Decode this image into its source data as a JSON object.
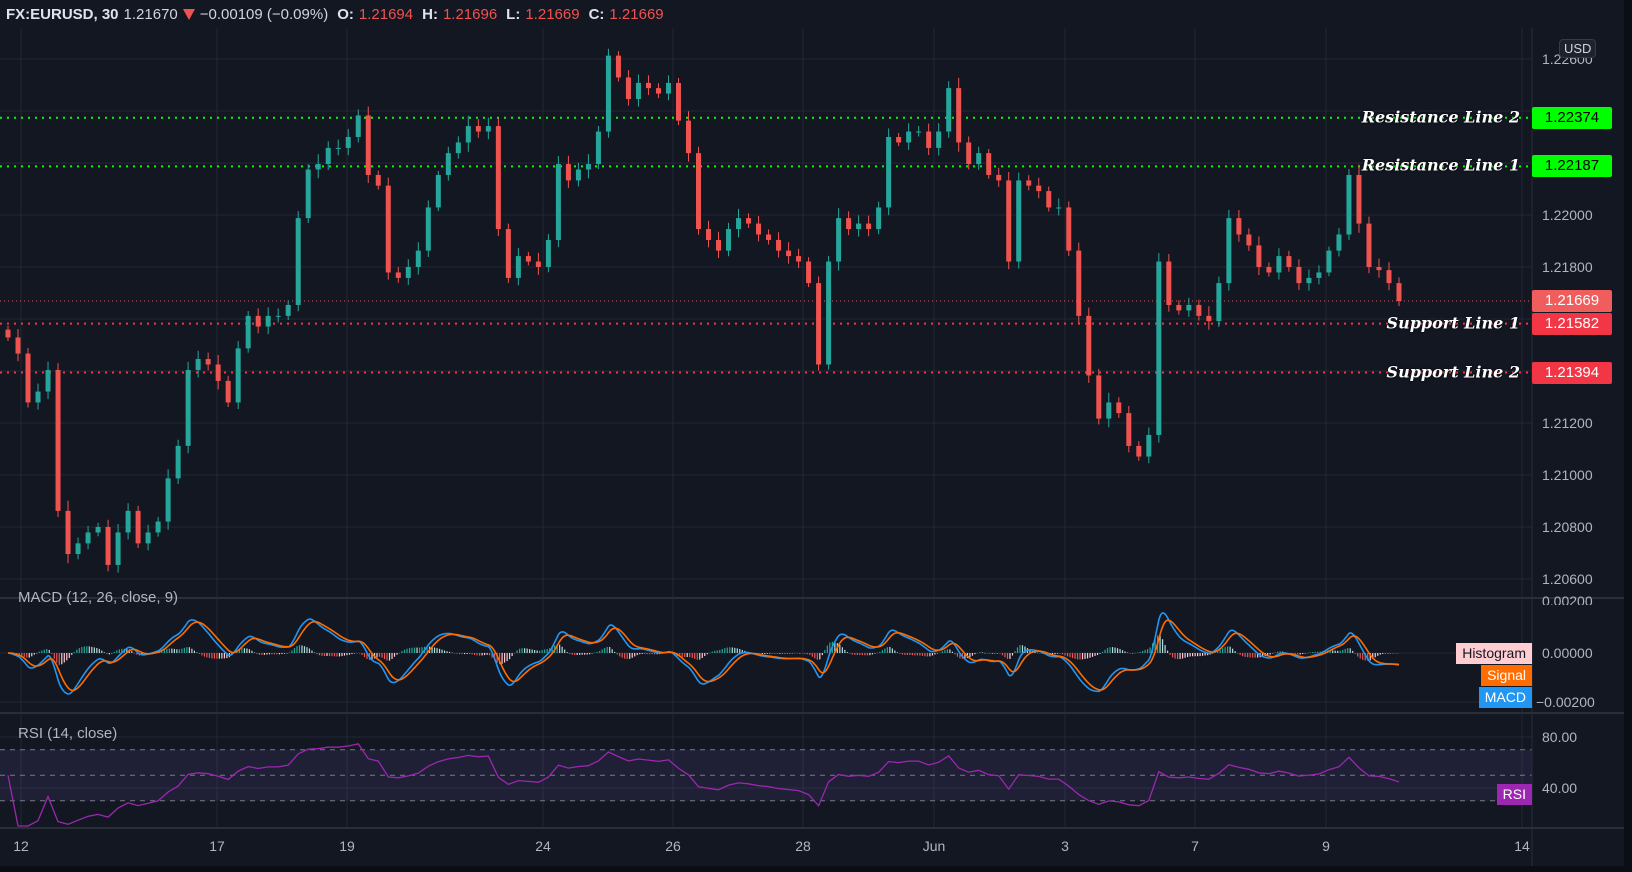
{
  "header": {
    "symbol": "FX:EURUSD, 30",
    "last": "1.21670",
    "change": "−0.00109 (−0.09%)",
    "o_label": "O:",
    "o": "1.21694",
    "h_label": "H:",
    "h": "1.21696",
    "l_label": "L:",
    "l": "1.21669",
    "c_label": "C:",
    "c": "1.21669",
    "direction_icon": "triangle-down-icon"
  },
  "price_axis": {
    "currency": "USD",
    "ticks": [
      "1.22600",
      "1.22000",
      "1.21800",
      "1.21200",
      "1.21000",
      "1.20800",
      "1.20600"
    ]
  },
  "levels": [
    {
      "label": "Resistance Line 2",
      "value": "1.22374",
      "color": "#00ff00"
    },
    {
      "label": "Resistance Line 1",
      "value": "1.22187",
      "color": "#00ff00"
    },
    {
      "label": "Support Line 1",
      "value": "1.21582",
      "color": "#f23645"
    },
    {
      "label": "Support Line 2",
      "value": "1.21394",
      "color": "#f23645"
    }
  ],
  "current_price": {
    "value": "1.21669",
    "color": "#f05d5d"
  },
  "indicators": {
    "macd": {
      "title": "MACD (12, 26, close, 9)",
      "ticks": [
        "0.00200",
        "0.00000",
        "−0.00200"
      ],
      "legend": [
        {
          "label": "Histogram",
          "color": "#ffcdd2"
        },
        {
          "label": "Signal",
          "color": "#ff6d00"
        },
        {
          "label": "MACD",
          "color": "#2196f3"
        }
      ]
    },
    "rsi": {
      "title": "RSI (14, close)",
      "ticks": [
        "80.00",
        "40.00"
      ],
      "legend": {
        "label": "RSI",
        "color": "#9c27b0"
      },
      "bands": [
        70,
        50,
        30
      ]
    }
  },
  "time_axis": [
    "12",
    "17",
    "19",
    "24",
    "26",
    "28",
    "Jun",
    "3",
    "7",
    "9",
    "14"
  ],
  "chart_data": {
    "type": "candlestick",
    "symbol": "FX:EURUSD",
    "interval": "30",
    "ylim": [
      1.2052,
      1.2275
    ],
    "up_color": "#26a69a",
    "down_color": "#ef5350",
    "close": [
      1.21529,
      1.21467,
      1.21279,
      1.21321,
      1.21404,
      1.20862,
      1.20696,
      1.20737,
      1.20779,
      1.208,
      1.20654,
      1.20779,
      1.20862,
      1.20737,
      1.20779,
      1.20821,
      1.20987,
      1.21112,
      1.21404,
      1.21446,
      1.21425,
      1.21362,
      1.21279,
      1.21487,
      1.21612,
      1.21571,
      1.21612,
      1.21612,
      1.21654,
      1.21988,
      1.22175,
      1.22196,
      1.22258,
      1.22258,
      1.223,
      1.22383,
      1.22154,
      1.22113,
      1.21779,
      1.21758,
      1.218,
      1.21863,
      1.22029,
      1.22154,
      1.22238,
      1.22279,
      1.22342,
      1.22321,
      1.22342,
      1.21946,
      1.21758,
      1.21842,
      1.21821,
      1.218,
      1.21904,
      1.22196,
      1.22133,
      1.22175,
      1.22196,
      1.22321,
      1.22613,
      1.22529,
      1.22446,
      1.22508,
      1.22488,
      1.22467,
      1.22508,
      1.22363,
      1.22238,
      1.21946,
      1.21904,
      1.21863,
      1.21946,
      1.21988,
      1.21967,
      1.21925,
      1.21904,
      1.21863,
      1.21842,
      1.21821,
      1.21738,
      1.21425,
      1.21821,
      1.21988,
      1.21946,
      1.21967,
      1.21946,
      1.22029,
      1.223,
      1.22279,
      1.22321,
      1.22321,
      1.22258,
      1.22321,
      1.22488,
      1.22279,
      1.22196,
      1.22238,
      1.22154,
      1.22133,
      1.21821,
      1.22133,
      1.22113,
      1.22092,
      1.22029,
      1.22029,
      1.21863,
      1.21612,
      1.21383,
      1.21217,
      1.21279,
      1.21238,
      1.21112,
      1.21071,
      1.21154,
      1.21821,
      1.21654,
      1.21633,
      1.21654,
      1.21612,
      1.21592,
      1.21738,
      1.21988,
      1.21925,
      1.21883,
      1.218,
      1.21779,
      1.21842,
      1.218,
      1.21738,
      1.21758,
      1.21779,
      1.21863,
      1.21925,
      1.22154,
      1.21967,
      1.218,
      1.21788,
      1.21738,
      1.21669
    ]
  }
}
